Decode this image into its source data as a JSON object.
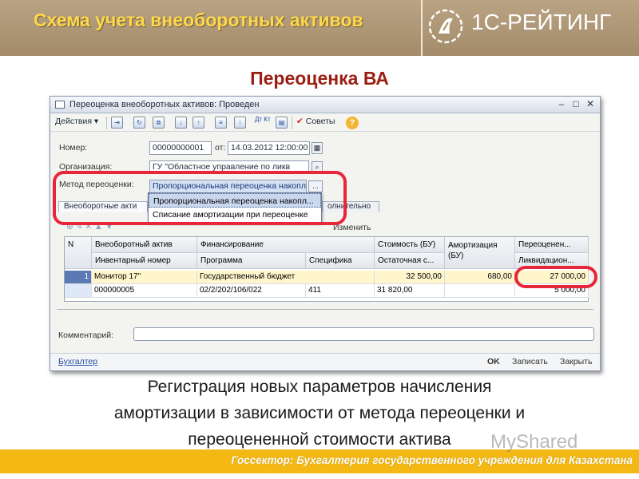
{
  "slide": {
    "header_title": "Схема учета внеоборотных активов",
    "logo_text": "1С-РЕЙТИНГ",
    "section_title": "Переоценка ВА",
    "caption_lines": [
      "Регистрация новых параметров начисления",
      "амортизации в зависимости от метода переоценки и",
      "переоцененной стоимости актива"
    ],
    "footer_text": "Госсектор: Бухгалтерия государственного учреждения для Казахстана",
    "watermark": "MyShared"
  },
  "window": {
    "title": "Переоценка внеоборотных активов: Проведен",
    "toolbar": {
      "actions_label": "Действия",
      "advice_label": "Советы",
      "dtkt_label": "Дт Кт"
    },
    "form": {
      "number_label": "Номер:",
      "number_value": "00000000001",
      "date_label": "от:",
      "date_value": "14.03.2012 12:00:00",
      "org_label": "Организация:",
      "org_value": "ГУ \"Областное управление по ликв",
      "method_label": "Метод переоценки:",
      "method_value": "Пропорциональная переоценка накопл",
      "dropdown_options": [
        "Пропорциональная переоценка накопл...",
        "Списание амортизации при переоценке"
      ]
    },
    "tabs": [
      "Внеоборотные акти",
      "олнительно"
    ],
    "table_toolbar_label": "Изменить",
    "table": {
      "headers_top": [
        "N",
        "Внеоборотный актив",
        "Финансирование",
        "Стоимость (БУ)",
        "Амортизация (БУ)",
        "Переоценен..."
      ],
      "headers_bottom": [
        "Инвентарный номер",
        "Программа",
        "Специфика",
        "Остаточная с...",
        "Ликвидацион..."
      ],
      "rows": [
        {
          "n": "1",
          "asset": "Монитор 17\"",
          "financing": "Государственный бюджет",
          "cost": "32 500,00",
          "amortization": "680,00",
          "revalued": "27 000,00",
          "inventory": "000000005",
          "program": "02/2/202/106/022",
          "specific": "411",
          "residual": "31 820,00",
          "liquidation": "5 000,00"
        }
      ]
    },
    "comment_label": "Комментарий:",
    "status": {
      "accountant_link": "Бухгалтер",
      "ok_label": "OK",
      "save_label": "Записать",
      "close_label": "Закрыть"
    }
  }
}
